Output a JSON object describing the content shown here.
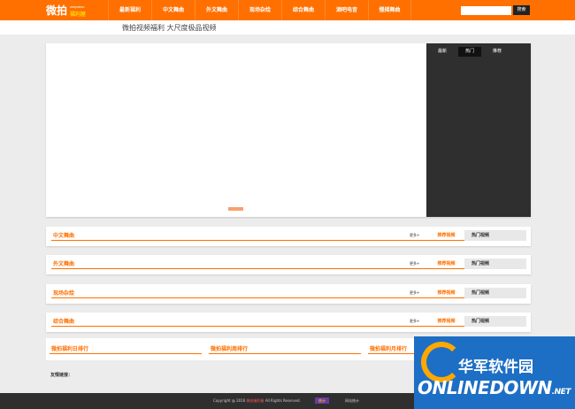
{
  "header": {
    "logo_text": "微拍",
    "logo_small": "weipaiwu",
    "logo_sub": "福利屋",
    "nav_items": [
      "最新福利",
      "中文舞曲",
      "外文舞曲",
      "现场杂烩",
      "综合舞曲",
      "酒吧电音",
      "慢摇舞曲"
    ],
    "search_placeholder": "",
    "search_button": "搜索"
  },
  "page_title": "微拍视频福利 大尺度极品视频",
  "side_panel": {
    "tabs": [
      "最新",
      "热门",
      "推荐"
    ],
    "active_tab": "热门"
  },
  "categories": [
    {
      "name": "中文舞曲",
      "more": "更多+",
      "tab_recommended": "推荐视频",
      "tab_hot": "热门视频"
    },
    {
      "name": "外文舞曲",
      "more": "更多+",
      "tab_recommended": "推荐视频",
      "tab_hot": "热门视频"
    },
    {
      "name": "现场杂烩",
      "more": "更多+",
      "tab_recommended": "推荐视频",
      "tab_hot": "热门视频"
    },
    {
      "name": "综合舞曲",
      "more": "更多+",
      "tab_recommended": "推荐视频",
      "tab_hot": "热门视频"
    }
  ],
  "rankings": [
    "微拍福利日排行",
    "微拍福利周排行",
    "微拍福利月排行"
  ],
  "friend_links": "友情链接：",
  "footer": {
    "copyright_prefix": "Copyright @ 2016 ",
    "brand": "微拍福利屋",
    "copyright_suffix": " All Rights Reserved.",
    "stat_logo": "统计",
    "stat": "网站统计"
  },
  "watermark": {
    "cn": "华军软件园",
    "en": "ONLINEDOWN",
    "net": ".NET"
  },
  "colors": {
    "accent": "#ff7000",
    "panel": "#2f2f2f",
    "watermark": "#1d6fc5"
  }
}
